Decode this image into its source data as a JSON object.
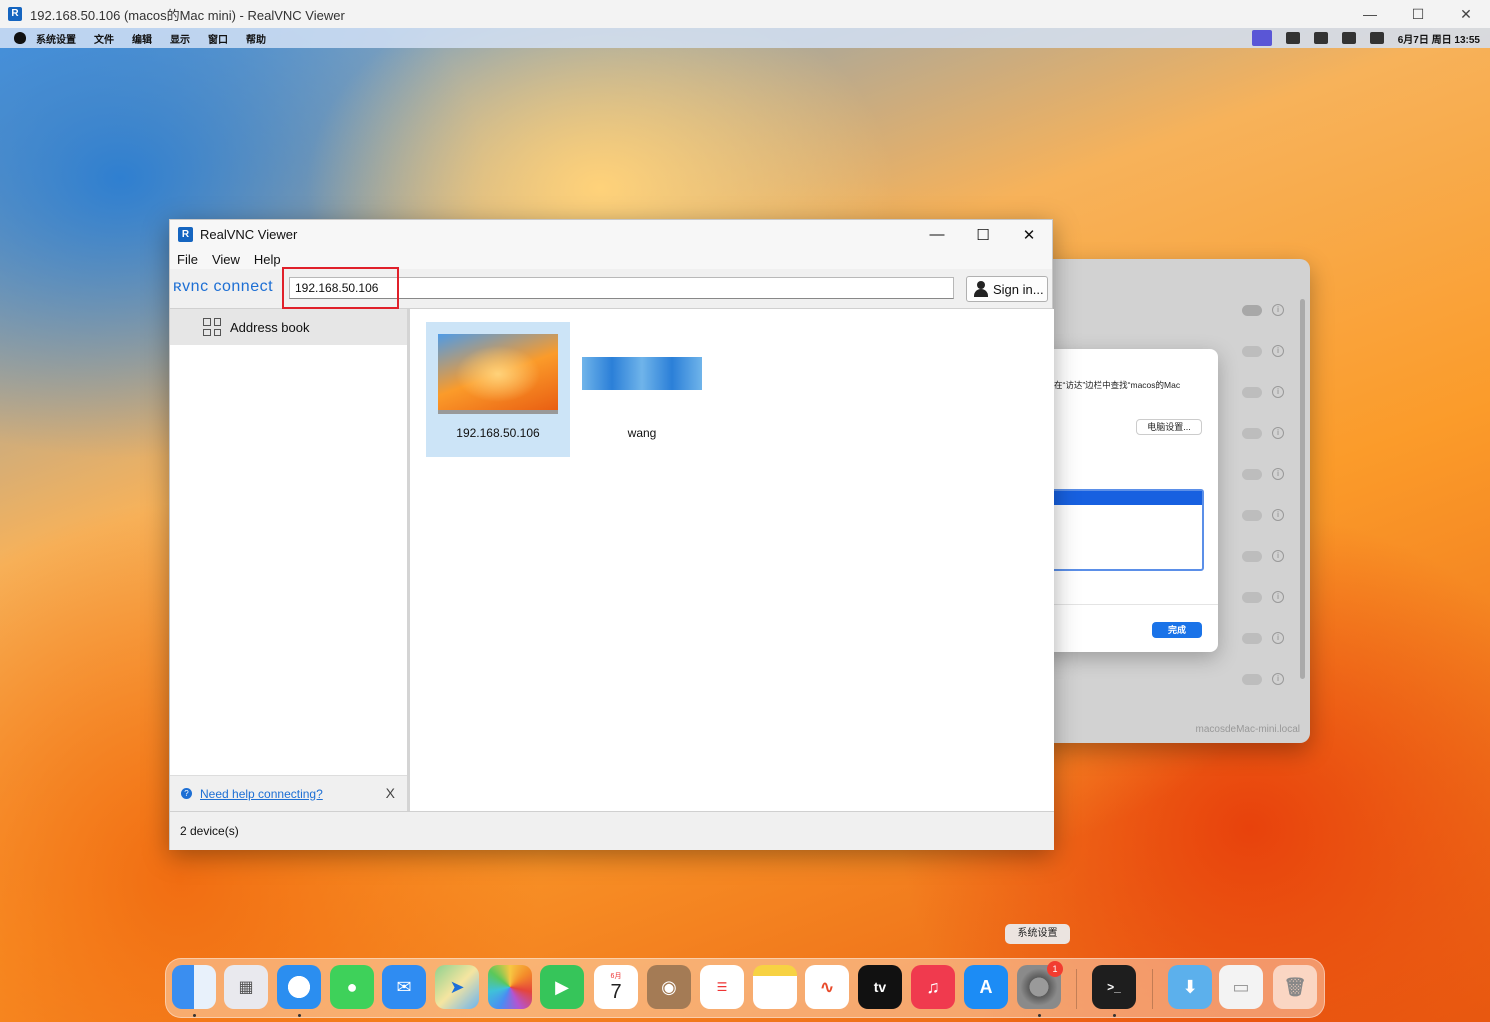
{
  "outer_window": {
    "title": "192.168.50.106 (macos的Mac mini) - RealVNC Viewer",
    "app_icon": "realvnc-icon",
    "controls": {
      "minimize": "—",
      "maximize": "☐",
      "close": "✕"
    }
  },
  "mac_menubar": {
    "items": [
      "系统设置",
      "文件",
      "编辑",
      "显示",
      "窗口",
      "帮助"
    ],
    "datetime": "6月7日 周日 13:55"
  },
  "mac_settings": {
    "sheet_text": "在“访达”边栏中查找“macos的Mac",
    "computer_settings_button": "电脑设置...",
    "done_button": "完成",
    "hostname": "macosdeMac-mini.local"
  },
  "dock": {
    "tooltip": "系统设置",
    "calendar_month": "6月",
    "calendar_day": "7",
    "settings_badge": "1"
  },
  "vnc_window": {
    "title": "RealVNC Viewer",
    "menu": [
      "File",
      "View",
      "Help"
    ],
    "logo": "ʀvnc connect",
    "address_value": "192.168.50.106",
    "signin_label": "Sign in...",
    "sidebar": {
      "address_book": "Address book",
      "help_link": "Need help connecting?",
      "help_close": "X"
    },
    "devices": [
      {
        "label": "192.168.50.106",
        "selected": true
      },
      {
        "label": "wang",
        "selected": false
      }
    ],
    "status": "2 device(s)"
  }
}
